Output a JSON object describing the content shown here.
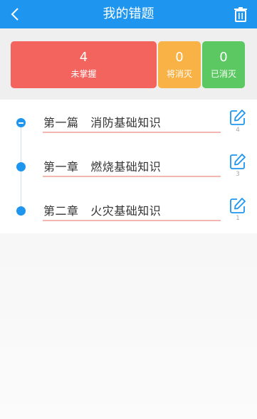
{
  "header": {
    "title": "我的错题",
    "back_icon": "chevron-left-icon",
    "trash_icon": "trash-icon"
  },
  "stats": {
    "unmastered": {
      "count": "4",
      "label": "未掌握",
      "color": "#f4645f"
    },
    "eliminating": {
      "count": "0",
      "label": "将消灭",
      "color": "#f8b246"
    },
    "eliminated": {
      "count": "0",
      "label": "已消灭",
      "color": "#5cc862"
    }
  },
  "list": {
    "items": [
      {
        "label": "第一篇   消防基础知识",
        "count": "4",
        "expanded": true
      },
      {
        "label": "第一章   燃烧基础知识",
        "count": "3"
      },
      {
        "label": "第二章   火灾基础知识",
        "count": "1"
      }
    ]
  },
  "colors": {
    "accent": "#1e96f0",
    "underline": "#f2b7b1"
  }
}
